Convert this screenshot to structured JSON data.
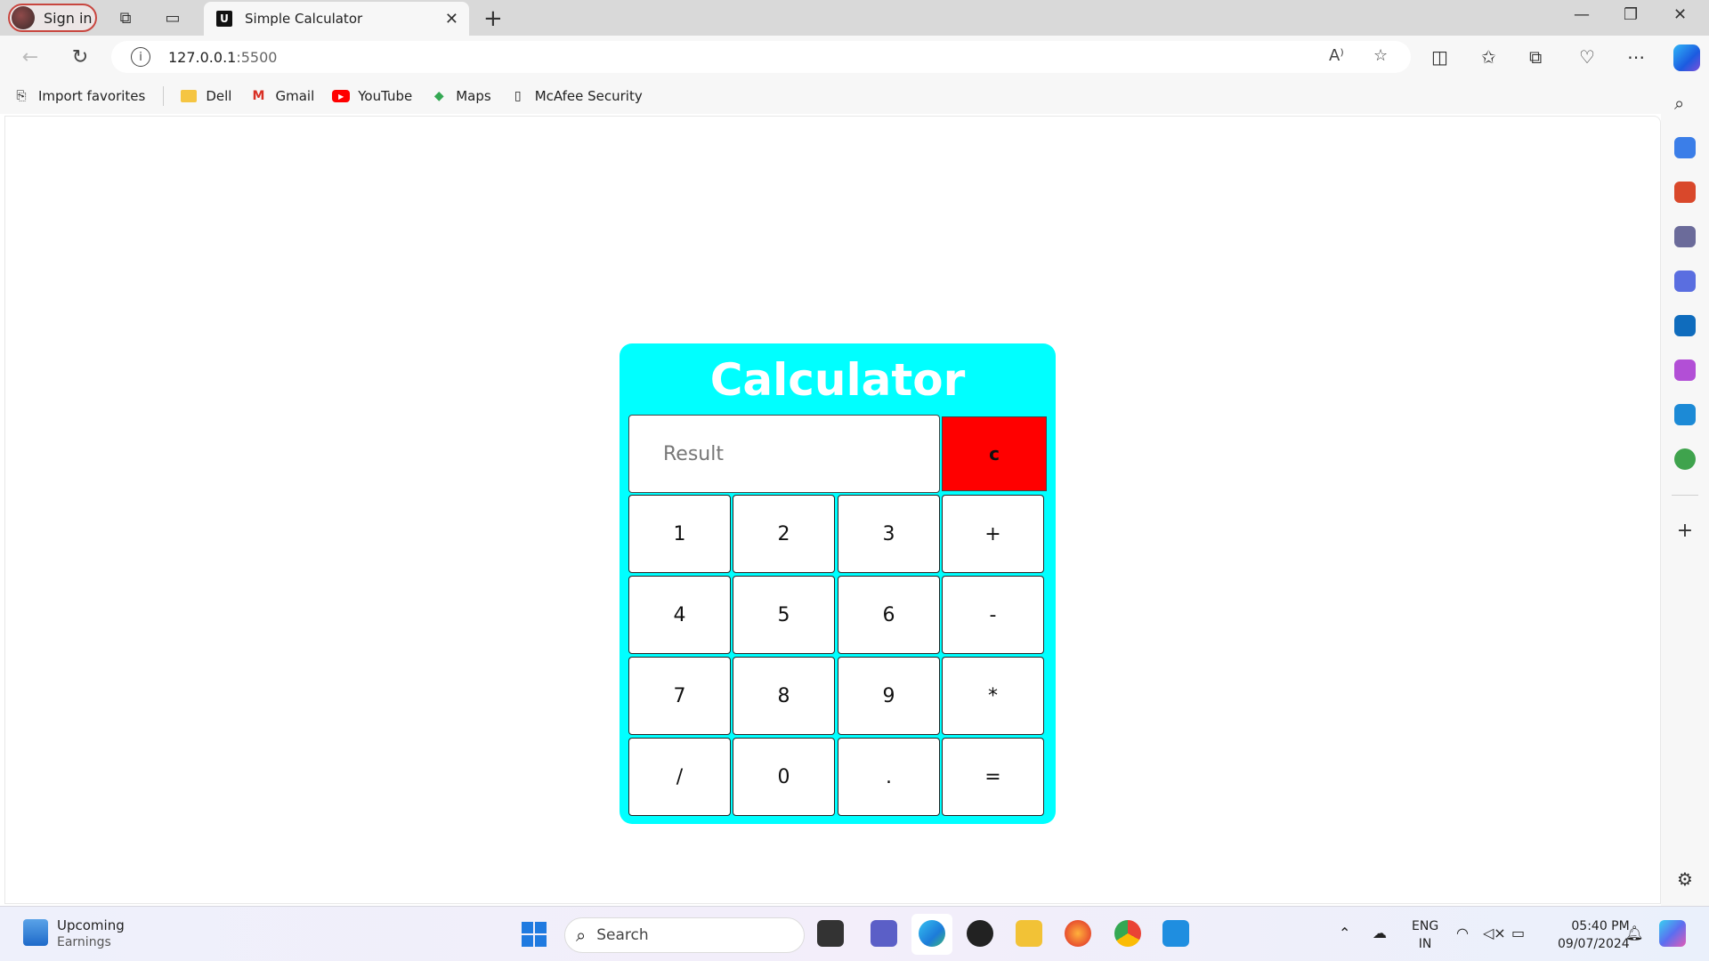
{
  "browser": {
    "signin_label": "Sign in",
    "tab_title": "Simple Calculator",
    "tab_favicon": "U",
    "url_host": "127.0.0.1",
    "url_port": ":5500"
  },
  "favorites": {
    "items": [
      {
        "label": "Import favorites",
        "icon": "import-icon"
      },
      {
        "label": "Dell",
        "icon": "folder-icon"
      },
      {
        "label": "Gmail",
        "icon": "gmail-icon"
      },
      {
        "label": "YouTube",
        "icon": "youtube-icon"
      },
      {
        "label": "Maps",
        "icon": "maps-icon"
      },
      {
        "label": "McAfee Security",
        "icon": "page-icon"
      }
    ]
  },
  "calculator": {
    "title": "Calculator",
    "result_placeholder": "Result",
    "clear_label": "c",
    "keys": [
      "1",
      "2",
      "3",
      "+",
      "4",
      "5",
      "6",
      "-",
      "7",
      "8",
      "9",
      "*",
      "/",
      "0",
      ".",
      "="
    ],
    "accent_color": "#00ffff",
    "clear_color": "#ff0000"
  },
  "taskbar": {
    "news_title": "Upcoming",
    "news_subtitle": "Earnings",
    "search_label": "Search",
    "lang_1": "ENG",
    "lang_2": "IN",
    "time": "05:40 PM",
    "date": "09/07/2024"
  }
}
